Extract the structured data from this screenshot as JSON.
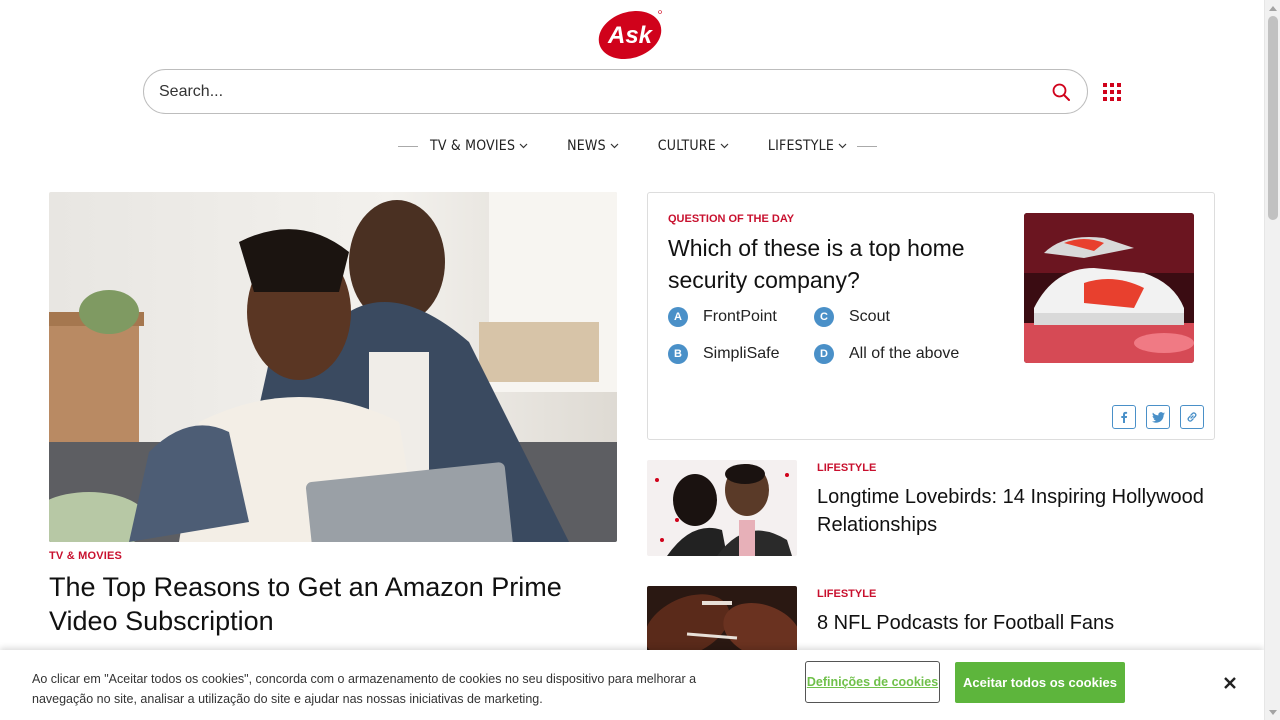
{
  "logo": {
    "text": "Ask",
    "color": "#d0021b"
  },
  "search": {
    "placeholder": "Search...",
    "icon": "search-icon"
  },
  "nav": {
    "items": [
      {
        "label": "TV & MOVIES"
      },
      {
        "label": "NEWS"
      },
      {
        "label": "CULTURE"
      },
      {
        "label": "LIFESTYLE"
      }
    ]
  },
  "hero": {
    "category": "TV & MOVIES",
    "title": "The Top Reasons to Get an Amazon Prime Video Subscription"
  },
  "qotd": {
    "label": "QUESTION OF THE DAY",
    "question": "Which of these is a top home security company?",
    "options": [
      {
        "letter": "A",
        "text": "FrontPoint"
      },
      {
        "letter": "B",
        "text": "SimpliSafe"
      },
      {
        "letter": "C",
        "text": "Scout"
      },
      {
        "letter": "D",
        "text": "All of the above"
      }
    ],
    "share": [
      "facebook-icon",
      "twitter-icon",
      "link-icon"
    ]
  },
  "articles": [
    {
      "category": "LIFESTYLE",
      "title": "Longtime Lovebirds: 14 Inspiring Hollywood Relationships"
    },
    {
      "category": "LIFESTYLE",
      "title": "8 NFL Podcasts for Football Fans"
    }
  ],
  "cookie": {
    "text": "Ao clicar em \"Aceitar todos os cookies\", concorda com o armazenamento de cookies no seu dispositivo para melhorar a navegação no site, analisar a utilização do site e ajudar nas nossas iniciativas de marketing.",
    "settings_label": "Definições de cookies",
    "accept_label": "Aceitar todos os cookies"
  },
  "colors": {
    "accent": "#c8102e",
    "option_blue": "#4a90c8",
    "accept_green": "#5db53c"
  }
}
